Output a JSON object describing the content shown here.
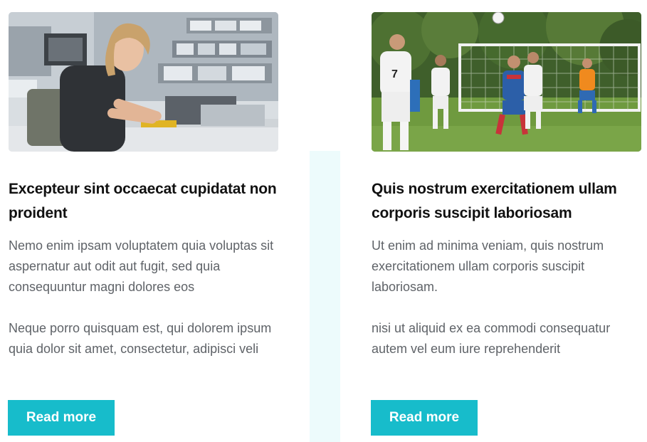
{
  "cards": [
    {
      "title": "Excepteur sint occaecat cupidatat non proident",
      "paragraph_1": "Nemo enim ipsam voluptatem quia voluptas sit aspernatur aut odit aut fugit, sed quia consequuntur magni dolores eos",
      "paragraph_2": "Neque porro quisquam est, qui dolorem ipsum quia dolor sit amet, consectetur, adipisci veli",
      "button_label": "Read more"
    },
    {
      "title": "Quis nostrum exercitationem ullam corporis suscipit laboriosam",
      "paragraph_1": "Ut enim ad minima veniam, quis nostrum exercitationem ullam corporis suscipit laboriosam.",
      "paragraph_2": "nisi ut aliquid ex ea commodi consequatur autem vel eum iure reprehenderit",
      "button_label": "Read more"
    }
  ],
  "colors": {
    "accent": "#17bccb",
    "title": "#111111",
    "body_text": "#5f6368",
    "divider_strip": "#edfbfc"
  }
}
